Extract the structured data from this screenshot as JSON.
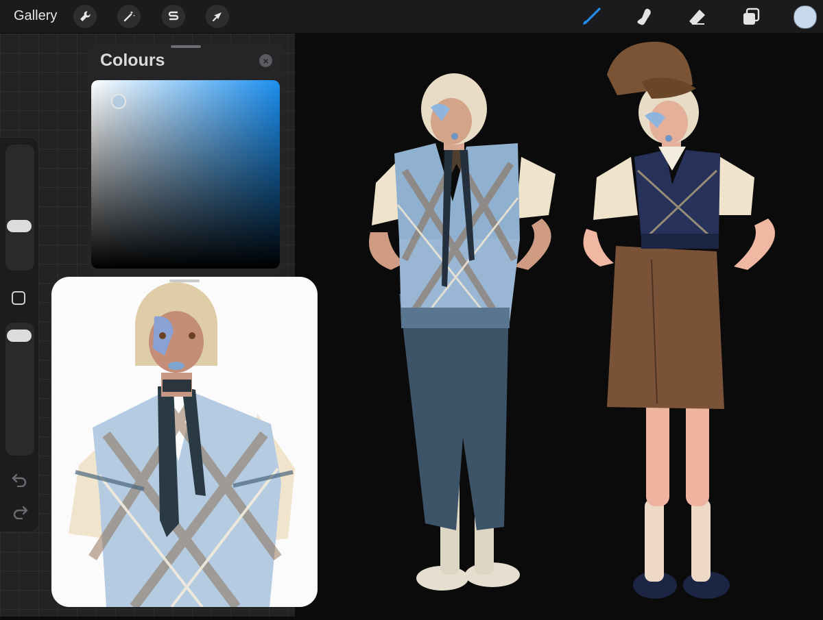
{
  "topbar": {
    "gallery_label": "Gallery",
    "left_tools": [
      "wrench-icon",
      "magic-wand-icon",
      "selection-icon",
      "transform-arrow-icon"
    ],
    "right_tools": [
      "brush-icon",
      "smudge-icon",
      "eraser-icon",
      "layers-icon"
    ],
    "active_tool": "brush",
    "current_color": "#c7d9ea",
    "accent_color": "#1f8ef1"
  },
  "colours_panel": {
    "title": "Colours",
    "close_glyph": "×",
    "hue_color": "#1b8ff0"
  },
  "sidebar": {
    "brush_size_level": 0.47,
    "opacity_level": 0.08
  },
  "reference_panel": {
    "content": "reference-artwork"
  },
  "canvas": {
    "background": "#0b0b0b",
    "figures": [
      "figure-left-argyle-vest-denim-skirt",
      "figure-right-cap-navy-vest-brown-shorts"
    ]
  }
}
